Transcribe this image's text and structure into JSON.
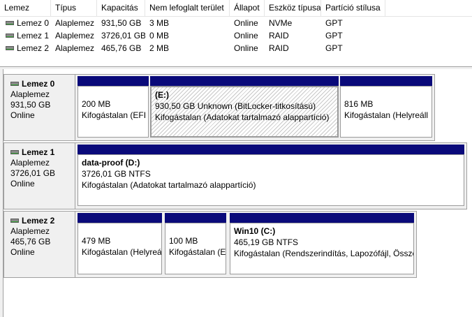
{
  "list": {
    "columns": [
      "Lemez",
      "Típus",
      "Kapacitás",
      "Nem lefoglalt terület",
      "Állapot",
      "Eszköz típusa",
      "Partíció stílusa"
    ],
    "rows": [
      {
        "lemez": "Lemez 0",
        "tipus": "Alaplemez",
        "kapacitas": "931,50 GB",
        "szabad": "3 MB",
        "allapot": "Online",
        "eszkoz": "NVMe",
        "stilus": "GPT"
      },
      {
        "lemez": "Lemez 1",
        "tipus": "Alaplemez",
        "kapacitas": "3726,01 GB",
        "szabad": "0 MB",
        "allapot": "Online",
        "eszkoz": "RAID",
        "stilus": "GPT"
      },
      {
        "lemez": "Lemez 2",
        "tipus": "Alaplemez",
        "kapacitas": "465,76 GB",
        "szabad": "2 MB",
        "allapot": "Online",
        "eszkoz": "RAID",
        "stilus": "GPT"
      }
    ]
  },
  "disks": [
    {
      "name": "Lemez 0",
      "type": "Alaplemez",
      "size": "931,50 GB",
      "status": "Online",
      "partitions": [
        {
          "title": "",
          "line1": "200 MB",
          "line2": "Kifogástalan (EFI"
        },
        {
          "title": "(E:)",
          "line1": "930,50 GB Unknown (BitLocker-titkosítású)",
          "line2": "Kifogástalan (Adatokat tartalmazó alappartíció)"
        },
        {
          "title": "",
          "line1": "816 MB",
          "line2": "Kifogástalan (Helyreáll"
        }
      ]
    },
    {
      "name": "Lemez 1",
      "type": "Alaplemez",
      "size": "3726,01 GB",
      "status": "Online",
      "partitions": [
        {
          "title": "data-proof  (D:)",
          "line1": "3726,01 GB NTFS",
          "line2": "Kifogástalan (Adatokat tartalmazó alappartíció)"
        }
      ]
    },
    {
      "name": "Lemez 2",
      "type": "Alaplemez",
      "size": "465,76 GB",
      "status": "Online",
      "partitions": [
        {
          "title": "",
          "line1": "479 MB",
          "line2": "Kifogástalan (Helyreá"
        },
        {
          "title": "",
          "line1": "100 MB",
          "line2": "Kifogástalan (E"
        },
        {
          "title": "Win10  (C:)",
          "line1": "465,19 GB NTFS",
          "line2": "Kifogástalan (Rendszerindítás, Lapozófájl, Össze"
        }
      ]
    }
  ],
  "colors": {
    "partition_bar": "#0a0a7a",
    "disk_icon_green": "#3aa63a"
  },
  "icons": {
    "disk": "disk-drive-icon"
  }
}
